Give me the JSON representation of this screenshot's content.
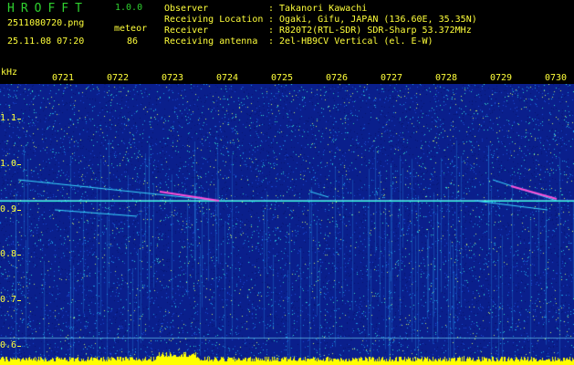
{
  "header": {
    "app_title": "HROFFT",
    "app_version": "1.0.0",
    "file_name": "2511080720.png",
    "date_time": "25.11.08 07:20",
    "mode_label": "meteor",
    "count_value": "86"
  },
  "station_info": [
    {
      "label": "Observer",
      "value": "Takanori Kawachi"
    },
    {
      "label": "Receiving Location",
      "value": "Ogaki, Gifu, JAPAN (136.60E, 35.35N)"
    },
    {
      "label": "Receiver",
      "value": "R820T2(RTL-SDR) SDR-Sharp 53.372MHz"
    },
    {
      "label": "Receiving antenna",
      "value": "2el-HB9CV Vertical (el. E-W)"
    }
  ],
  "spectrogram": {
    "unit": "kHz",
    "y_ticks": [
      "1.1",
      "1.0",
      "0.9",
      "0.8",
      "0.7",
      "0.6"
    ],
    "x_ticks": [
      "0721",
      "0722",
      "0723",
      "0724",
      "0725",
      "0726",
      "0727",
      "0728",
      "0729",
      "0730"
    ],
    "colors": {
      "background": "#0a1f8c",
      "label": "#ffff3a",
      "title": "#2fd12f",
      "carrier": "#33ffd9",
      "echo": "#ff4fd8",
      "noise_floor": "#ffff00"
    }
  }
}
